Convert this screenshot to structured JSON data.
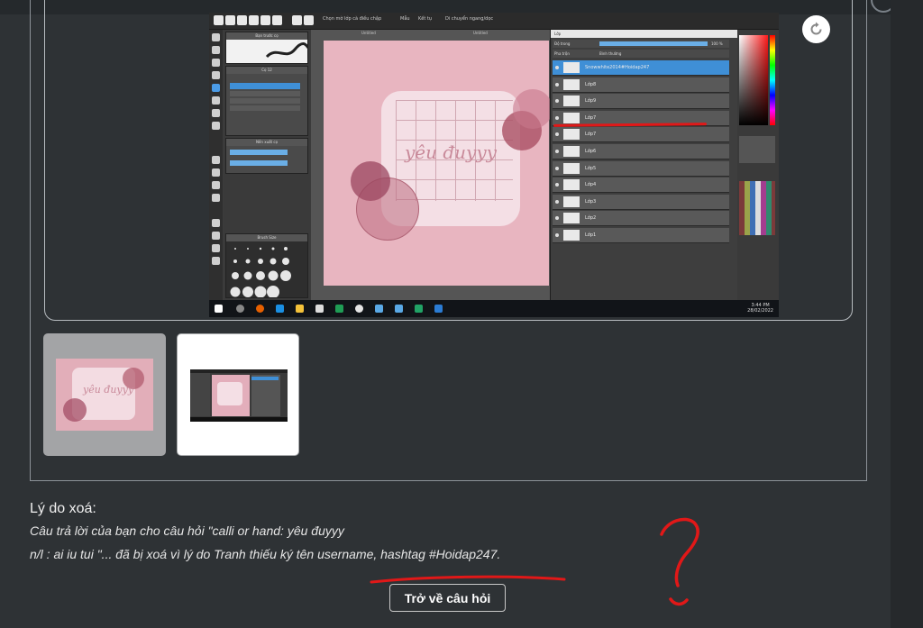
{
  "screenshot": {
    "toolbar": {
      "items": [
        "Chọn mờ lớp cà điều chập",
        "Mẫu",
        "Kết tụ",
        "Di chuyển ngang/dọc"
      ]
    },
    "canvas_tabs": [
      "Untitled",
      "Untitled"
    ],
    "canvas_text": "yêu đuyyy",
    "left_panels": [
      "Bạn trước cọ",
      "Cọ 12",
      "Nền xuất cọ",
      "Brush Size"
    ],
    "layers_panel": {
      "title": "Lớp",
      "opacity_label": "Độ trong",
      "opacity_value": "100 %",
      "blend_label": "Pha trộn",
      "blend_value": "Bình thường",
      "layers": [
        "Snowwhite2014#Hoidap247",
        "Lớp8",
        "Lớp9",
        "Lớp7",
        "Lớp7",
        "Lớp6",
        "Lớp5",
        "Lớp4",
        "Lớp3",
        "Lớp2",
        "Lớp1"
      ]
    },
    "clock": {
      "time": "3:44 PM",
      "date": "28/02/2022"
    },
    "colors": {
      "canvas_bg": "#e8b5c0",
      "selected_layer": "#3f8fd6"
    }
  },
  "deletion": {
    "title": "Lý do xoá:",
    "line1": "Câu trả lời của bạn cho câu hỏi \"calli or hand: yêu đuyyy",
    "line2": "n/l : ai iu tui \"... đã bị xoá vì lý do Tranh thiếu ký tên username, hashtag #Hoidap247."
  },
  "back_button": "Trở về câu hỏi",
  "colors": {
    "page_bg": "#2e3235",
    "annotation_red": "#e11818"
  }
}
